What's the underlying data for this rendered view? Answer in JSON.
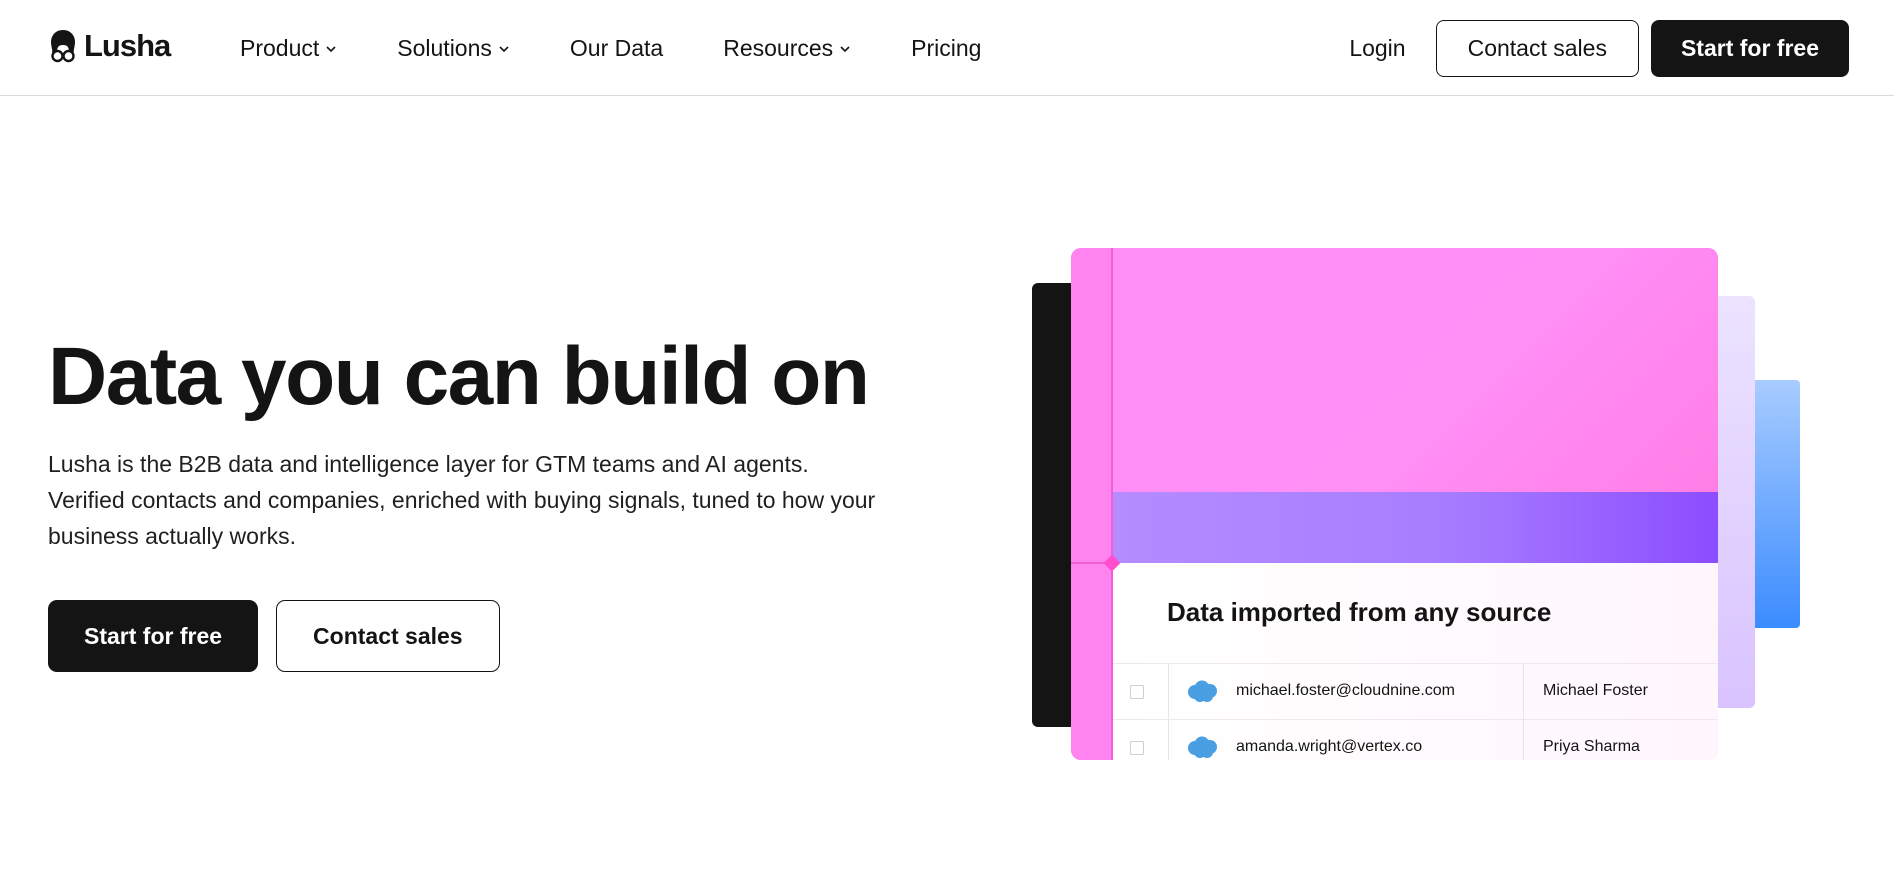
{
  "brand": {
    "name": "Lusha",
    "logo_icon": "lusha-glasses-logo-icon"
  },
  "nav": {
    "items": [
      {
        "label": "Product",
        "has_dropdown": true
      },
      {
        "label": "Solutions",
        "has_dropdown": true
      },
      {
        "label": "Our Data",
        "has_dropdown": false
      },
      {
        "label": "Resources",
        "has_dropdown": true
      },
      {
        "label": "Pricing",
        "has_dropdown": false
      }
    ],
    "login_label": "Login",
    "contact_label": "Contact sales",
    "start_label": "Start for free"
  },
  "hero": {
    "title": "Data you can build on",
    "subtitle": "Lusha is the B2B data and intelligence layer for GTM teams and AI agents. Verified contacts and companies, enriched with buying signals, tuned to how your business actually works.",
    "primary_cta": "Start for free",
    "secondary_cta": "Contact sales"
  },
  "illustration": {
    "heading": "Data imported from any source",
    "rows": [
      {
        "email": "michael.foster@cloudnine.com",
        "name": "Michael Foster",
        "icon": "salesforce-cloud-icon"
      },
      {
        "email": "amanda.wright@vertex.co",
        "name": "Priya Sharma",
        "icon": "salesforce-cloud-icon"
      }
    ]
  },
  "colors": {
    "ink": "#141414",
    "pink": "#ff8cf5",
    "purple": "#a77dff",
    "lavender": "#e3d4ff",
    "blue": "#3b8cff",
    "salesforce": "#4a9fe3"
  }
}
